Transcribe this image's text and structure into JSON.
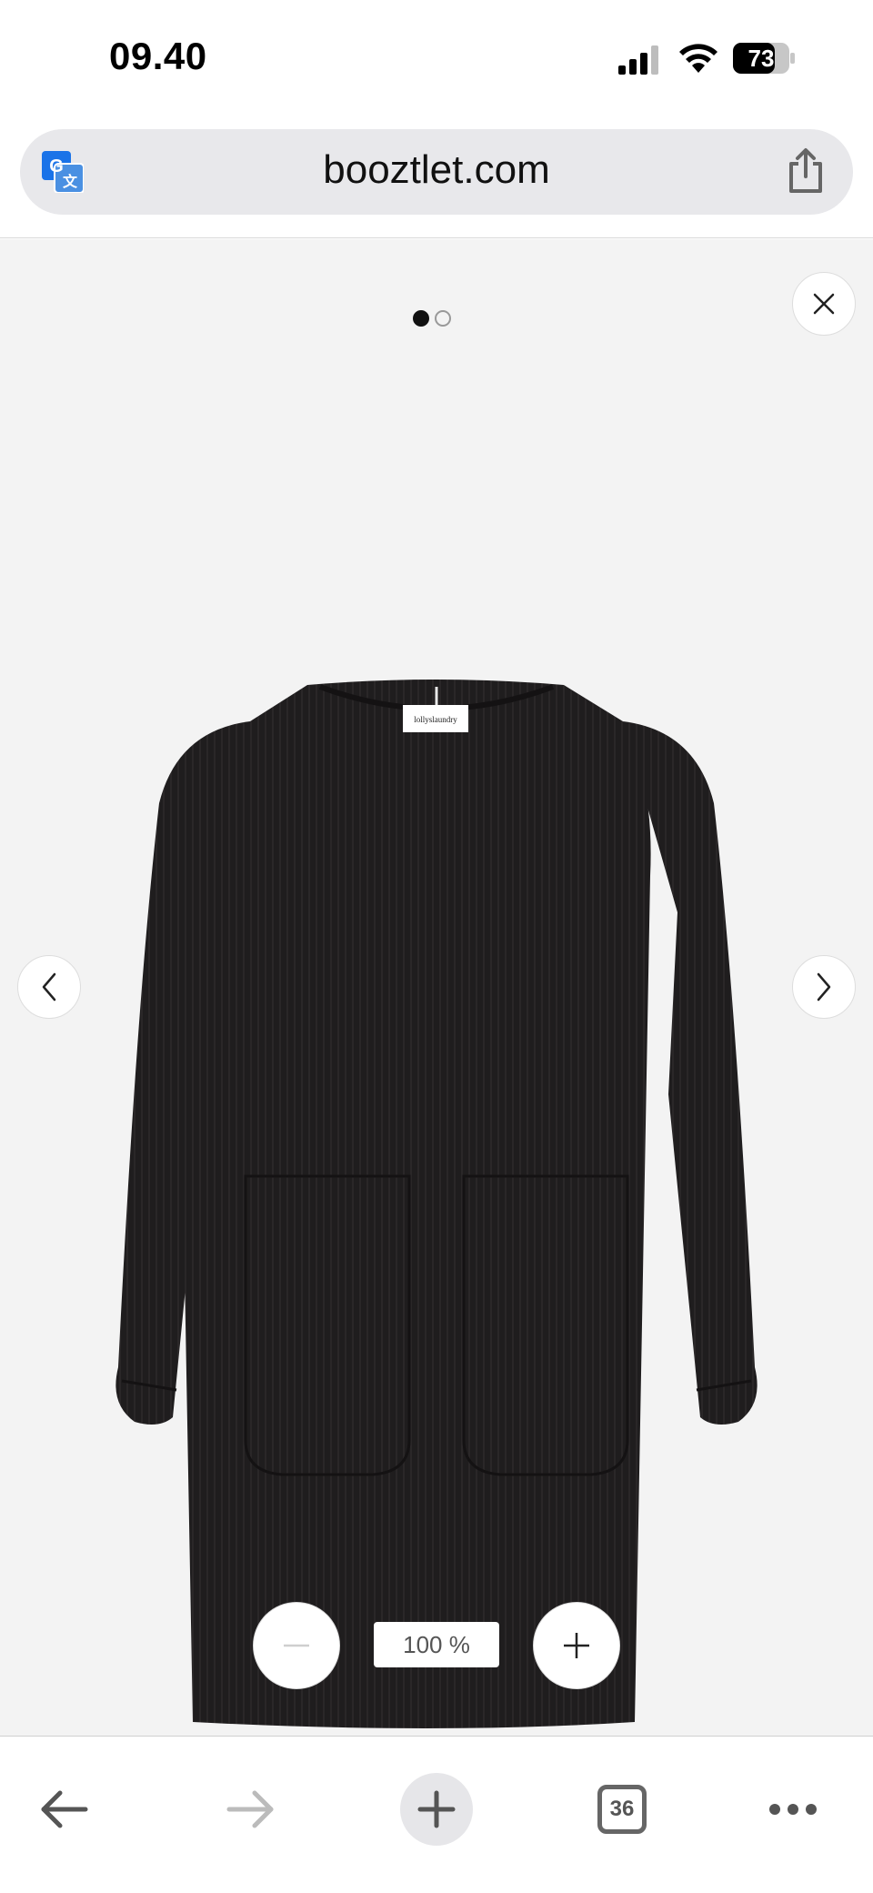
{
  "status_bar": {
    "time": "09.40",
    "battery": "73"
  },
  "browser": {
    "url": "booztlet.com",
    "icons": [
      "translate-icon",
      "share-icon"
    ]
  },
  "viewer": {
    "page_indicator": {
      "total": 2,
      "active": 1
    },
    "product_label": "lollyslaundry",
    "zoom_level": "100 %",
    "icons": [
      "close-icon",
      "chevron-left-icon",
      "chevron-right-icon",
      "minus-icon",
      "plus-icon"
    ]
  },
  "toolbar": {
    "tabs_count": "36",
    "icons": [
      "back-arrow-icon",
      "forward-arrow-icon",
      "new-tab-plus-icon",
      "tabs-icon",
      "more-dots-icon"
    ]
  },
  "colors": {
    "viewer_bg": "#f3f3f3",
    "garment": "#1f1d1e",
    "url_bar_bg": "#e8e8eb"
  }
}
